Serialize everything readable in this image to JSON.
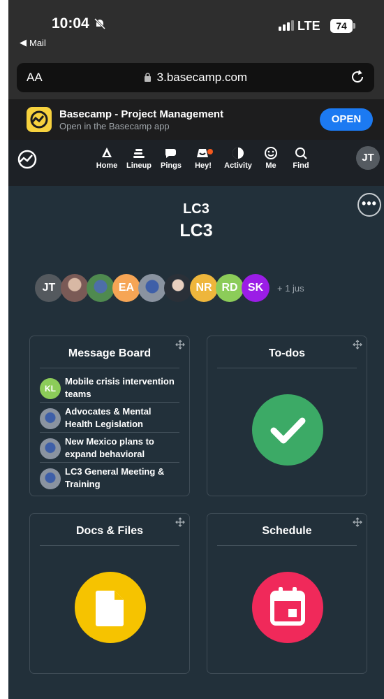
{
  "status": {
    "time": "10:04",
    "back": "Mail",
    "network": "LTE",
    "battery": "74"
  },
  "browser": {
    "text_size": "AA",
    "url": "3.basecamp.com"
  },
  "banner": {
    "title": "Basecamp - Project Management",
    "subtitle": "Open in the Basecamp app",
    "open_label": "OPEN"
  },
  "nav": {
    "items": [
      {
        "label": "Home",
        "icon": "home-icon"
      },
      {
        "label": "Lineup",
        "icon": "lineup-icon"
      },
      {
        "label": "Pings",
        "icon": "pings-icon"
      },
      {
        "label": "Hey!",
        "icon": "hey-icon"
      },
      {
        "label": "Activity",
        "icon": "activity-icon"
      },
      {
        "label": "Me",
        "icon": "me-icon"
      },
      {
        "label": "Find",
        "icon": "find-icon"
      }
    ],
    "avatar": "JT"
  },
  "project": {
    "team": "LC3",
    "name": "LC3",
    "more": "•••"
  },
  "people": {
    "avatars": [
      {
        "initials": "JT",
        "color": "#54595e"
      },
      {
        "initials": "",
        "color": "#9d7b73"
      },
      {
        "initials": "",
        "color": "#3f7a4a"
      },
      {
        "initials": "EA",
        "color": "#f6a555"
      },
      {
        "initials": "",
        "color": "#6e84a5"
      },
      {
        "initials": "",
        "color": "#3c4c5a"
      },
      {
        "initials": "NR",
        "color": "#eeb63c"
      },
      {
        "initials": "RD",
        "color": "#8ccc59"
      },
      {
        "initials": "SK",
        "color": "#9b1de6"
      }
    ],
    "more": "+ 1 jus"
  },
  "cards": {
    "message_board": {
      "title": "Message Board",
      "messages": [
        {
          "initials": "KL",
          "color": "#8ccc59",
          "title": "Mobile crisis intervention teams"
        },
        {
          "initials": "",
          "color": "#6e84a5",
          "title": "Advocates & Mental Health Legislation"
        },
        {
          "initials": "",
          "color": "#6e84a5",
          "title": "New Mexico plans to expand behavioral"
        },
        {
          "initials": "",
          "color": "#6e84a5",
          "title": "LC3 General Meeting & Training"
        }
      ]
    },
    "todos": {
      "title": "To-dos",
      "color": "#3caa66"
    },
    "docs": {
      "title": "Docs & Files",
      "color": "#f6c300"
    },
    "schedule": {
      "title": "Schedule",
      "color": "#f0295a"
    }
  }
}
